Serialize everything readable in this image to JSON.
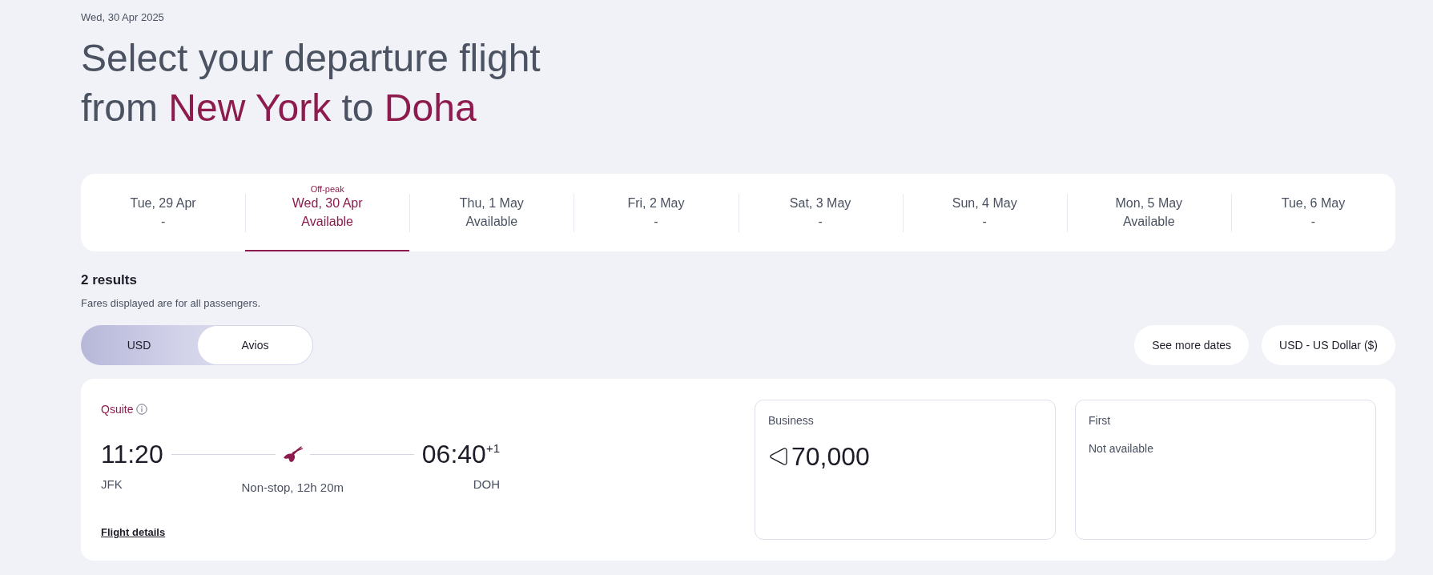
{
  "header": {
    "date": "Wed, 30 Apr 2025",
    "title_lines": [
      [
        {
          "text": "Select your departure flight",
          "highlight": false
        }
      ],
      [
        {
          "text": "from",
          "highlight": false
        },
        {
          "text": "New York",
          "highlight": true
        },
        {
          "text": "to",
          "highlight": false
        },
        {
          "text": "Doha",
          "highlight": true
        }
      ]
    ]
  },
  "date_tabs": [
    {
      "day": "Tue, 29 Apr",
      "availability": "-",
      "selected": false
    },
    {
      "tag": "Off-peak",
      "day": "Wed, 30 Apr",
      "availability": "Available",
      "selected": true
    },
    {
      "day": "Thu, 1 May",
      "availability": "Available",
      "selected": false
    },
    {
      "day": "Fri, 2 May",
      "availability": "-",
      "selected": false
    },
    {
      "day": "Sat, 3 May",
      "availability": "-",
      "selected": false
    },
    {
      "day": "Sun, 4 May",
      "availability": "-",
      "selected": false
    },
    {
      "day": "Mon, 5 May",
      "availability": "Available",
      "selected": false
    },
    {
      "day": "Tue, 6 May",
      "availability": "-",
      "selected": false
    }
  ],
  "results": {
    "count": "2 results",
    "note": "Fares displayed are for all passengers."
  },
  "currency_toggle": [
    {
      "label": "USD",
      "selected": false
    },
    {
      "label": "Avios",
      "selected": true
    }
  ],
  "actions": [
    "See more dates",
    "USD - US Dollar ($)"
  ],
  "flights": [
    {
      "product": "Qsuite",
      "depart_time": "11:20",
      "depart_airport": "JFK",
      "arrive_time": "06:40$^{+1}$",
      "arrive_airport": "DOH",
      "duration": "Non-stop, 12h 20m",
      "details_link": "Flight details",
      "fares": [
        {
          "kind": "price",
          "cabin": "Business",
          "price": "70,000"
        },
        {
          "kind": "unavailable",
          "cabin": "First",
          "note": "Not available"
        }
      ]
    }
  ]
}
